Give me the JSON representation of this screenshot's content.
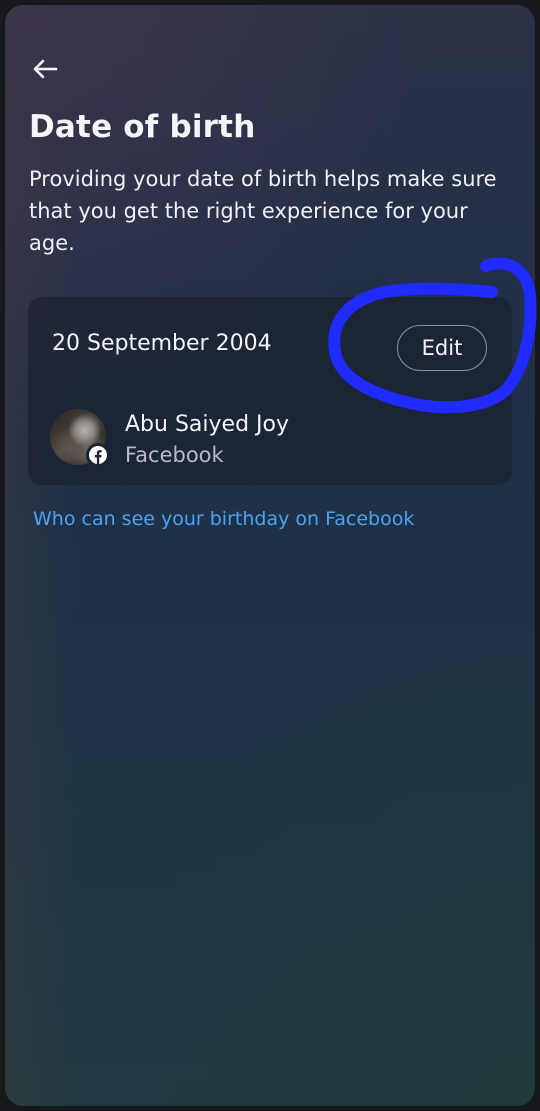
{
  "header": {
    "title": "Date of birth",
    "description": "Providing your date of birth helps make sure that you get the right experience for your age."
  },
  "birthday_card": {
    "date": "20 September 2004",
    "edit_label": "Edit",
    "account": {
      "name": "Abu Saiyed Joy",
      "platform": "Facebook"
    }
  },
  "links": {
    "visibility_label": "Who can see your birthday on Facebook"
  },
  "icons": {
    "back": "back-arrow-icon",
    "platform_badge": "facebook-icon"
  },
  "colors": {
    "link": "#4aa3f5",
    "annotation": "#1f2bff",
    "facebook_badge": "#ffffff"
  }
}
